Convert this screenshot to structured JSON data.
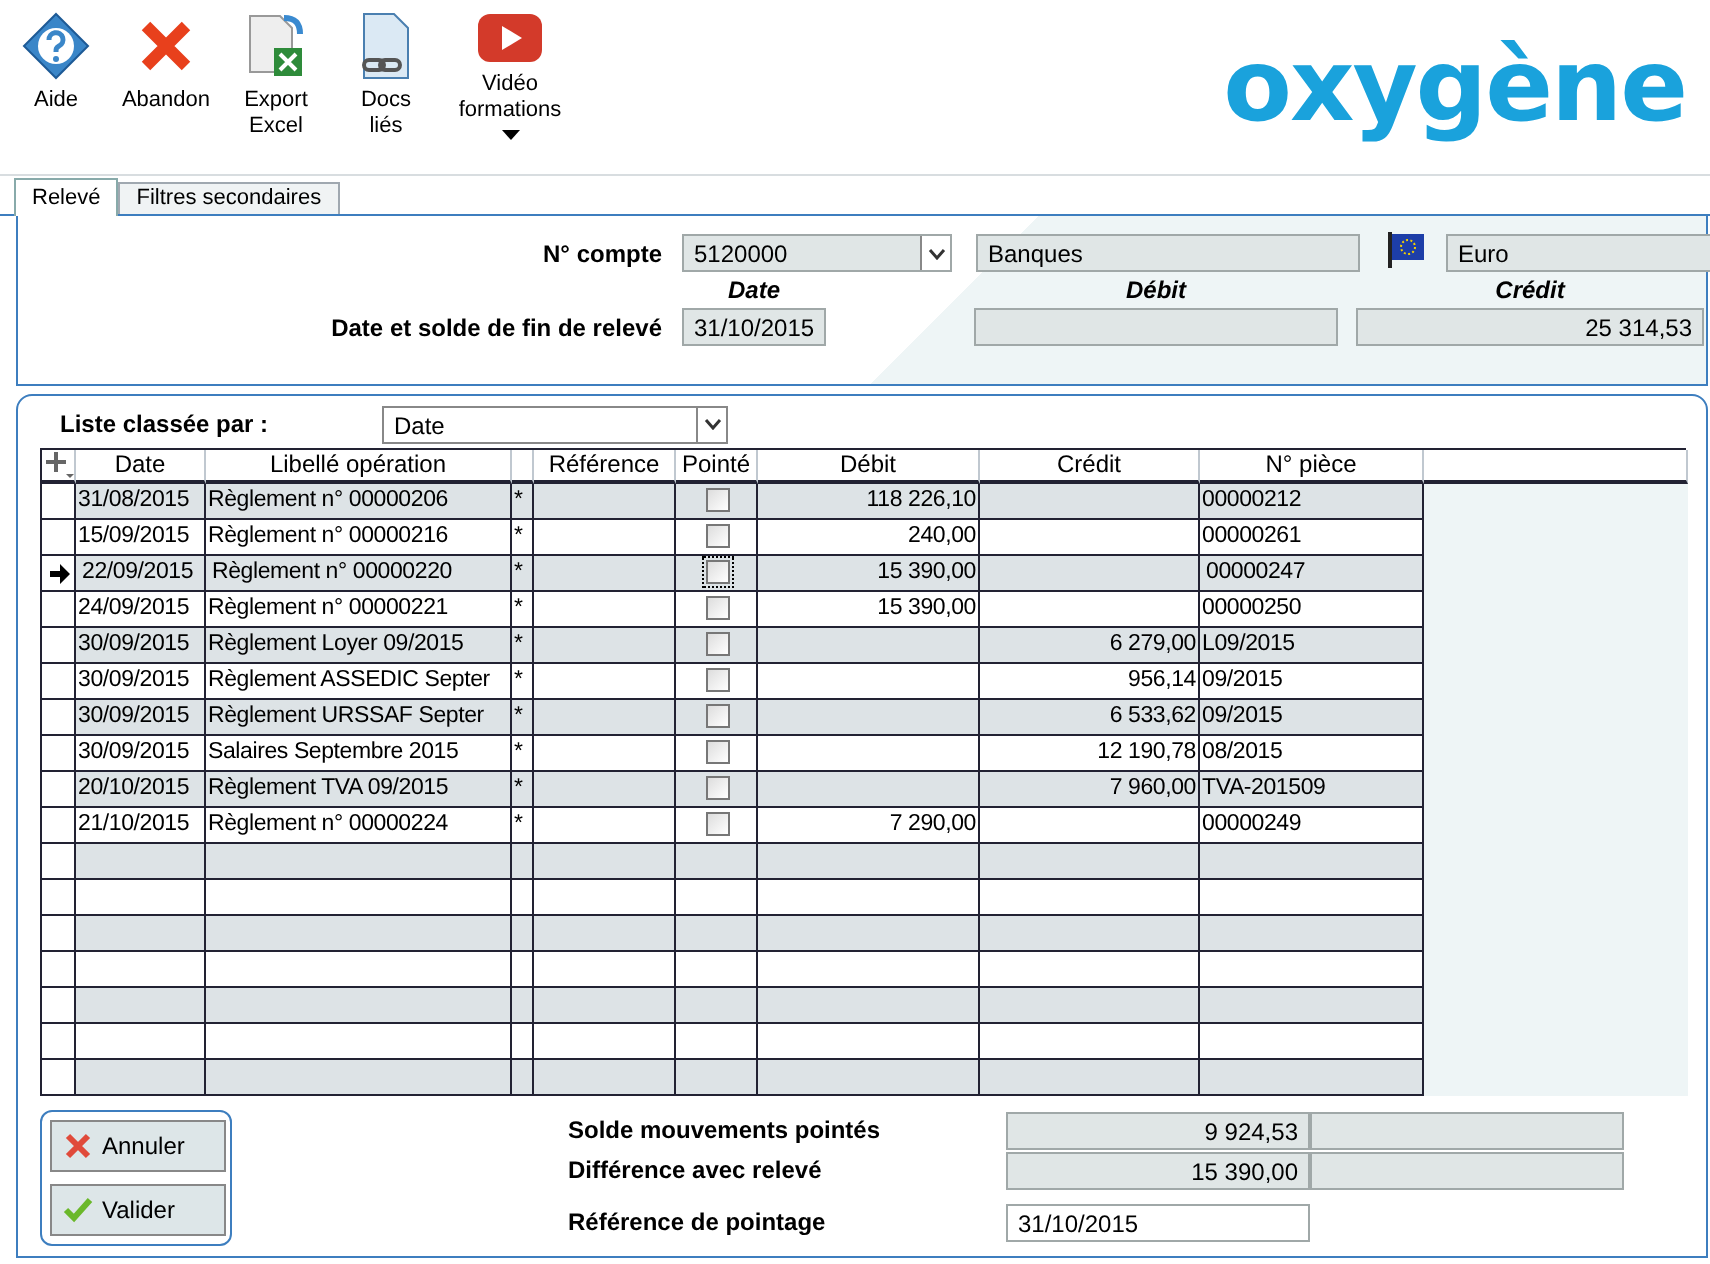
{
  "toolbar": [
    {
      "kind": "help",
      "label": "Aide"
    },
    {
      "kind": "cancel",
      "label": "Abandon"
    },
    {
      "kind": "excel",
      "label": "Export\nExcel"
    },
    {
      "kind": "docs",
      "label": "Docs\nliés"
    },
    {
      "kind": "video",
      "label": "Vidéo\nformations",
      "dropdown": true
    }
  ],
  "logo": "oxygène",
  "tabs": [
    {
      "label": "Relevé",
      "selected": true
    },
    {
      "label": "Filtres secondaires",
      "selected": false
    }
  ],
  "header": {
    "account_label": "N° compte",
    "account": "5120000",
    "account_name": "Banques",
    "currency": "Euro",
    "col_date": "Date",
    "col_debit": "Débit",
    "col_credit": "Crédit",
    "end_label": "Date et solde de fin de relevé",
    "end_date": "31/10/2015",
    "end_credit": "25 314,53"
  },
  "sort": {
    "label": "Liste classée par :",
    "value": "Date"
  },
  "table": {
    "columns": [
      "Date",
      "Libellé opération",
      "",
      "Référence",
      "Pointé",
      "Débit",
      "Crédit",
      "N° pièce"
    ],
    "rows": [
      {
        "date": "31/08/2015",
        "label": "Règlement n° 00000206",
        "mark": "*",
        "debit": "118 226,10",
        "credit": "",
        "piece": "00000212",
        "checked": false,
        "selected": false
      },
      {
        "date": "15/09/2015",
        "label": "Règlement n° 00000216",
        "mark": "*",
        "debit": "240,00",
        "credit": "",
        "piece": "00000261",
        "checked": false,
        "selected": false
      },
      {
        "date": "22/09/2015",
        "label": "Règlement n° 00000220",
        "mark": "*",
        "debit": "15 390,00",
        "credit": "",
        "piece": "00000247",
        "checked": false,
        "selected": true
      },
      {
        "date": "24/09/2015",
        "label": "Règlement n° 00000221",
        "mark": "*",
        "debit": "15 390,00",
        "credit": "",
        "piece": "00000250",
        "checked": false,
        "selected": false
      },
      {
        "date": "30/09/2015",
        "label": "Règlement Loyer 09/2015",
        "mark": "*",
        "debit": "",
        "credit": "6 279,00",
        "piece": "L09/2015",
        "checked": false,
        "selected": false
      },
      {
        "date": "30/09/2015",
        "label": "Règlement ASSEDIC Septer",
        "mark": "*",
        "debit": "",
        "credit": "956,14",
        "piece": "09/2015",
        "checked": false,
        "selected": false
      },
      {
        "date": "30/09/2015",
        "label": "Règlement URSSAF Septer",
        "mark": "*",
        "debit": "",
        "credit": "6 533,62",
        "piece": "09/2015",
        "checked": false,
        "selected": false
      },
      {
        "date": "30/09/2015",
        "label": "Salaires Septembre 2015",
        "mark": "*",
        "debit": "",
        "credit": "12 190,78",
        "piece": "08/2015",
        "checked": false,
        "selected": false
      },
      {
        "date": "20/10/2015",
        "label": "Règlement TVA 09/2015",
        "mark": "*",
        "debit": "",
        "credit": "7 960,00",
        "piece": "TVA-201509",
        "checked": false,
        "selected": false
      },
      {
        "date": "21/10/2015",
        "label": "Règlement n° 00000224",
        "mark": "*",
        "debit": "7 290,00",
        "credit": "",
        "piece": "00000249",
        "checked": false,
        "selected": false
      }
    ]
  },
  "buttons": [
    {
      "kind": "cancel",
      "label": "Annuler"
    },
    {
      "kind": "ok",
      "label": "Valider"
    }
  ],
  "summary": [
    {
      "label": "Solde mouvements pointés",
      "value": "9 924,53"
    },
    {
      "label": "Différence avec relevé",
      "value": "15 390,00"
    }
  ],
  "reference": {
    "label": "Référence de pointage",
    "value": "31/10/2015"
  }
}
